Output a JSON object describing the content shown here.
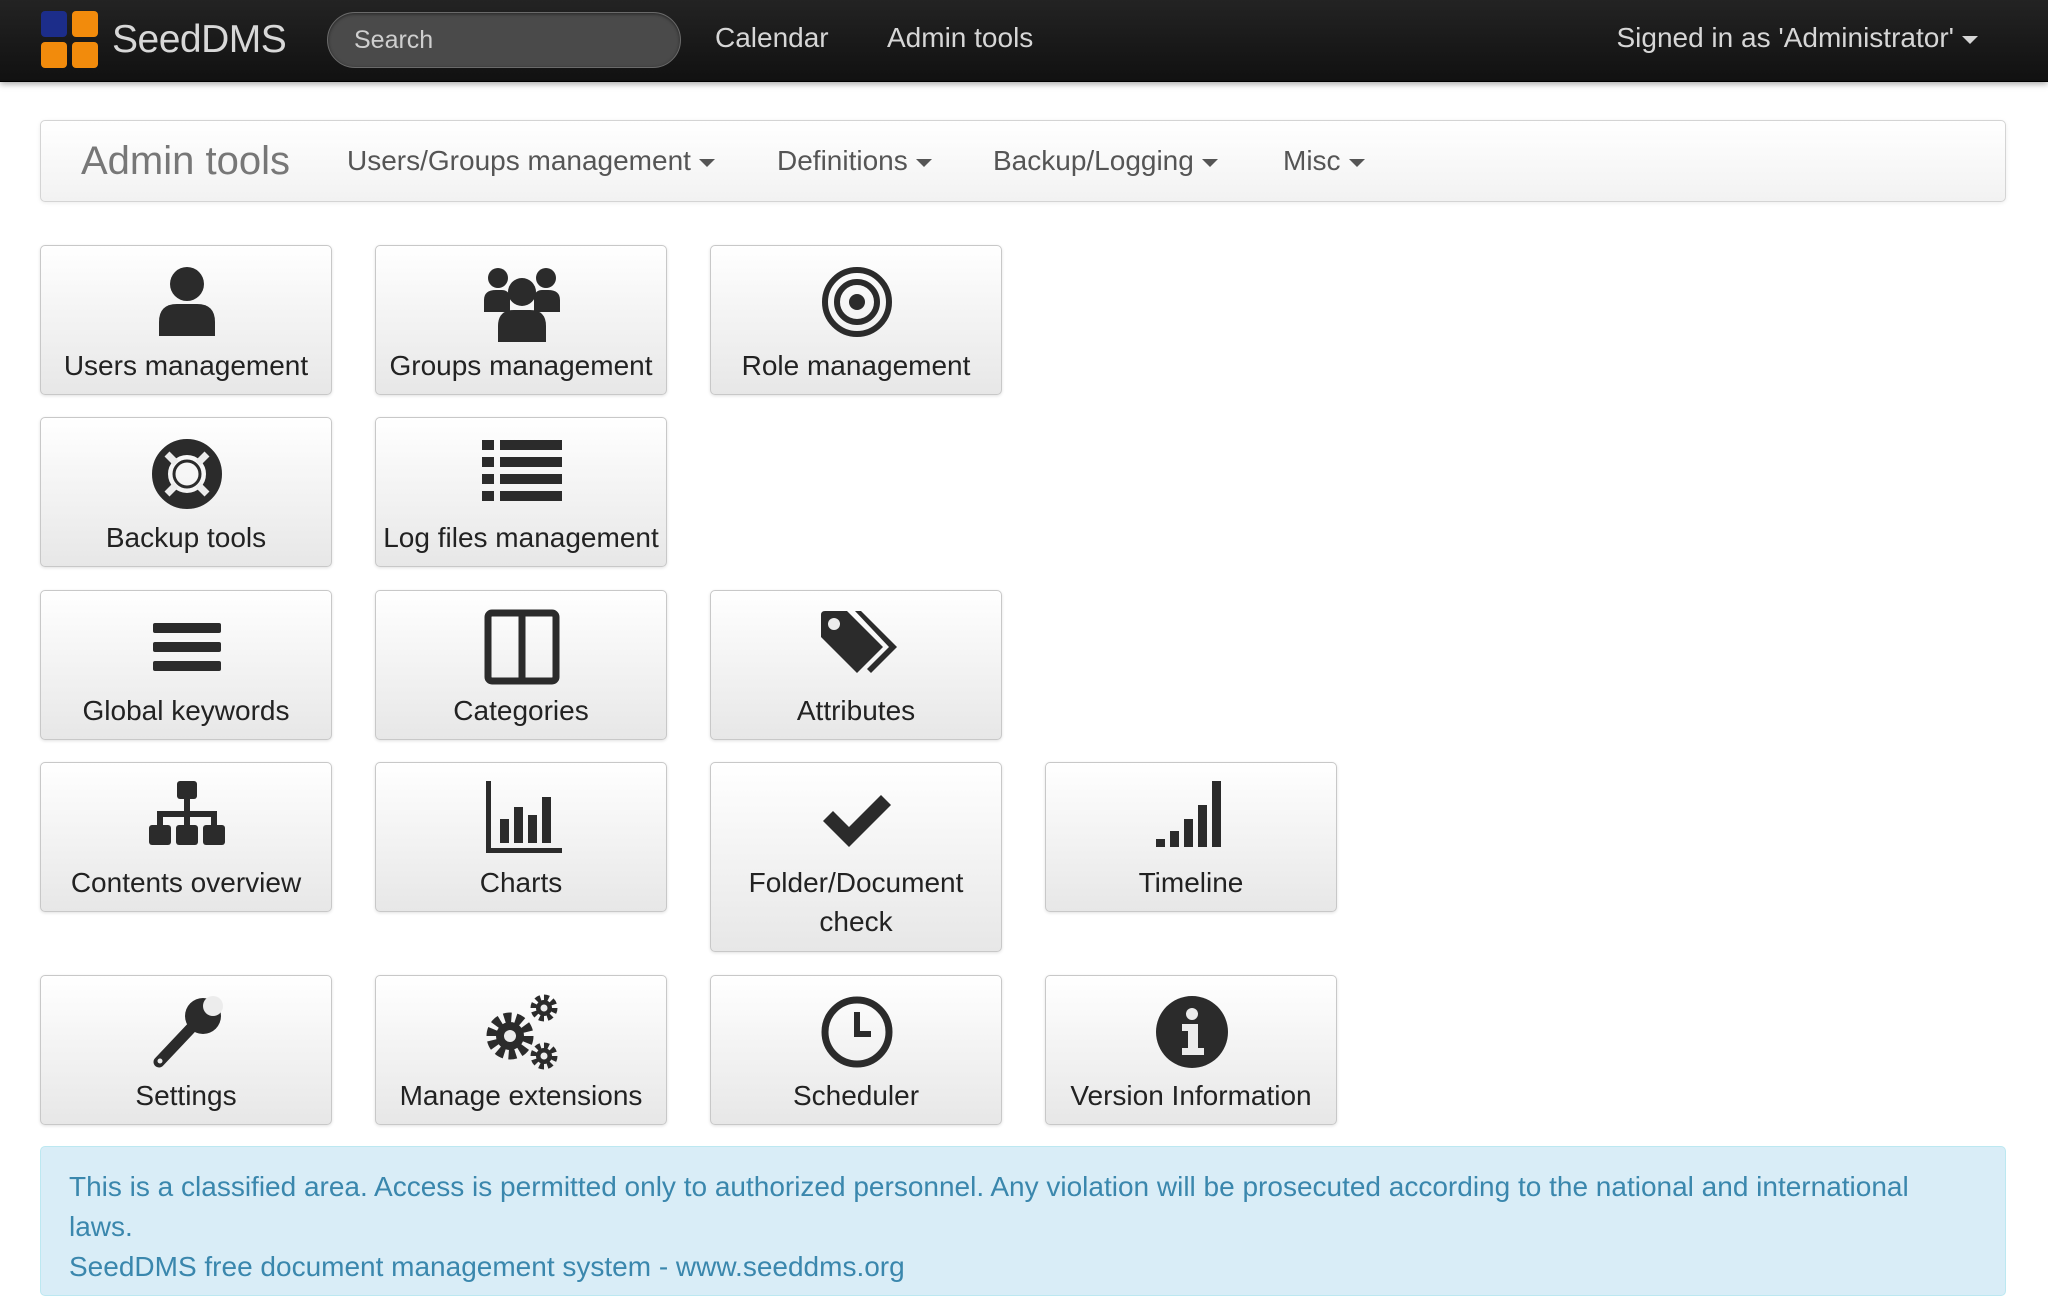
{
  "navbar": {
    "brand": "SeedDMS",
    "search_placeholder": "Search",
    "links": {
      "calendar": "Calendar",
      "admin_tools": "Admin tools"
    },
    "user_menu": "Signed in as 'Administrator'"
  },
  "subnav": {
    "title": "Admin tools",
    "menus": [
      "Users/Groups management",
      "Definitions",
      "Backup/Logging",
      "Misc"
    ]
  },
  "tiles": [
    {
      "label": "Users management",
      "icon": "user-icon"
    },
    {
      "label": "Groups management",
      "icon": "group-icon"
    },
    {
      "label": "Role management",
      "icon": "bullseye-icon"
    },
    {
      "label": "Backup tools",
      "icon": "lifebuoy-icon"
    },
    {
      "label": "Log files management",
      "icon": "list-icon"
    },
    {
      "label": "Global keywords",
      "icon": "bars-icon"
    },
    {
      "label": "Categories",
      "icon": "columns-icon"
    },
    {
      "label": "Attributes",
      "icon": "tags-icon"
    },
    {
      "label": "Contents overview",
      "icon": "sitemap-icon"
    },
    {
      "label": "Charts",
      "icon": "bar-chart-icon"
    },
    {
      "label": "Folder/Document check",
      "icon": "check-icon"
    },
    {
      "label": "Timeline",
      "icon": "signal-icon"
    },
    {
      "label": "Settings",
      "icon": "wrench-icon"
    },
    {
      "label": "Manage extensions",
      "icon": "cogs-icon"
    },
    {
      "label": "Scheduler",
      "icon": "clock-icon"
    },
    {
      "label": "Version Information",
      "icon": "info-icon"
    }
  ],
  "footer": {
    "notice": "This is a classified area. Access is permitted only to authorized personnel. Any violation will be prosecuted according to the national and international laws.",
    "credit": "SeedDMS free document management system - www.seeddms.org"
  },
  "colors": {
    "navbar_bg": "#1b1b1b",
    "logo_blue": "#1c2d8a",
    "logo_orange": "#f28b0c",
    "icon": "#2b2b2b",
    "alert_bg": "#d9edf7",
    "alert_text": "#3a87ad"
  }
}
